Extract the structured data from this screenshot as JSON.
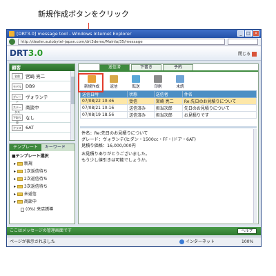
{
  "callout": {
    "label": "新規作成ボタンをクリック"
  },
  "window": {
    "title": "[DRT3.0] message tool - Windows Internet Explorer",
    "url": "http://dealer.autobytel-japan.com/drt3demo/Mainla/35/message"
  },
  "app": {
    "logo_prefix": "DRT",
    "logo_version": "3.0",
    "close_label": "閉じる"
  },
  "customer": {
    "header": "顧客",
    "rows": [
      {
        "tag": "名前",
        "value": "宮崎 亮二"
      },
      {
        "tag": "モデル",
        "value": "DB9"
      },
      {
        "tag": "グレード",
        "value": "ヴォランテ"
      },
      {
        "tag": "ステータス",
        "value": "商談中"
      },
      {
        "tag": "下取り車",
        "value": "なし"
      },
      {
        "tag": "クラス",
        "value": "6AT"
      }
    ]
  },
  "templates": {
    "tabs": [
      "テンプレート",
      "キーワード"
    ],
    "section": "■テンプレート選択",
    "items": [
      "新規",
      "1次返信待ち",
      "2次返信待ち",
      "3次返信待ち",
      "未返信",
      "商談中"
    ],
    "subitem": "(0%) 来店誘導"
  },
  "tabs": [
    "送信済",
    "下書き",
    "予約"
  ],
  "toolbar": [
    {
      "label": "新規作成",
      "icon": "new-message-icon",
      "color": "#e9a23b"
    },
    {
      "label": "返信",
      "icon": "reply-icon",
      "color": "#d7a94a"
    },
    {
      "label": "転送",
      "icon": "forward-icon",
      "color": "#5aa8d8"
    },
    {
      "label": "印刷",
      "icon": "print-icon",
      "color": "#8c8c8c"
    },
    {
      "label": "未読",
      "icon": "unread-icon",
      "color": "#6fa4d6"
    }
  ],
  "table": {
    "headers": [
      "送信日時",
      "状態",
      "送信者",
      "件名"
    ],
    "rows": [
      {
        "date": "07/08/22 10:46",
        "status": "受信",
        "sender": "宮崎 亮二",
        "subject": "Re:先日のお見積りについて"
      },
      {
        "date": "07/08/21 10:16",
        "status": "送信済み",
        "sender": "担当次郎",
        "subject": "先日のお見積りについて"
      },
      {
        "date": "07/08/19 18:56",
        "status": "送信済み",
        "sender": "担当次郎",
        "subject": "お見積りです"
      }
    ]
  },
  "detail": {
    "subject": "件名：Re:先日のお見積りについて",
    "grade": "グレード：ヴォランテ(ヒダン・1500cc・FF・(ドア・6AT)",
    "amount": "見積り価格：16,000,000円",
    "line1": "お見積りありがとうございました。",
    "line2": "もう少し値引きは可能でしょうか。"
  },
  "footer": {
    "text": "ここはメッセージの管理画面です",
    "help": "ヘルプ"
  },
  "status": {
    "left": "ページが表示されました",
    "zone": "インターネット",
    "zoom": "100%"
  },
  "colors": {
    "accent_green": "#3e8a3e",
    "header_blue": "#4c8fc4",
    "highlight": "#fde7a8",
    "callout_red": "#e23a2a"
  }
}
